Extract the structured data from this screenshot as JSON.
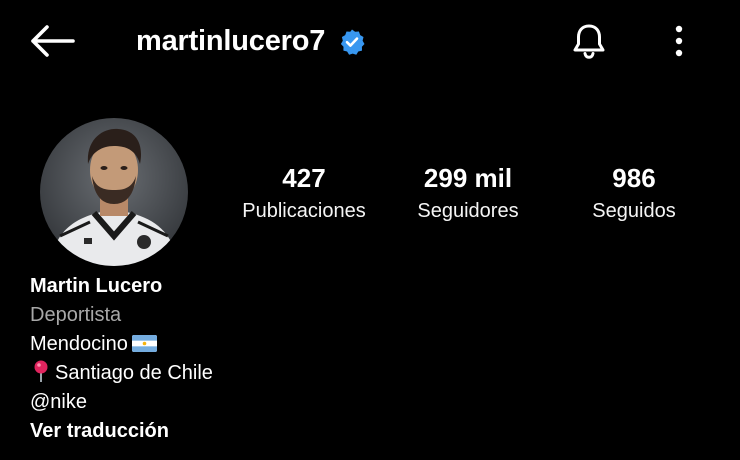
{
  "header": {
    "username": "martinlucero7",
    "verified": true,
    "accent_color": "#3897f0"
  },
  "icons": {
    "back": "back-arrow-icon",
    "verified": "verified-badge-icon",
    "notifications": "bell-icon",
    "more": "more-vertical-icon"
  },
  "stats": {
    "posts": {
      "value": "427",
      "label": "Publicaciones"
    },
    "followers": {
      "value": "299 mil",
      "label": "Seguidores"
    },
    "following": {
      "value": "986",
      "label": "Seguidos"
    }
  },
  "bio": {
    "name": "Martin Lucero",
    "category": "Deportista",
    "line1": "Mendocino",
    "line1_emoji": "argentina-flag",
    "line2": "Santiago de Chile",
    "line2_emoji": "round-pushpin",
    "mention": "@nike",
    "translate_label": "Ver traducción"
  },
  "colors": {
    "background": "#000000",
    "text": "#ffffff",
    "secondary_text": "#a8a8a8"
  }
}
